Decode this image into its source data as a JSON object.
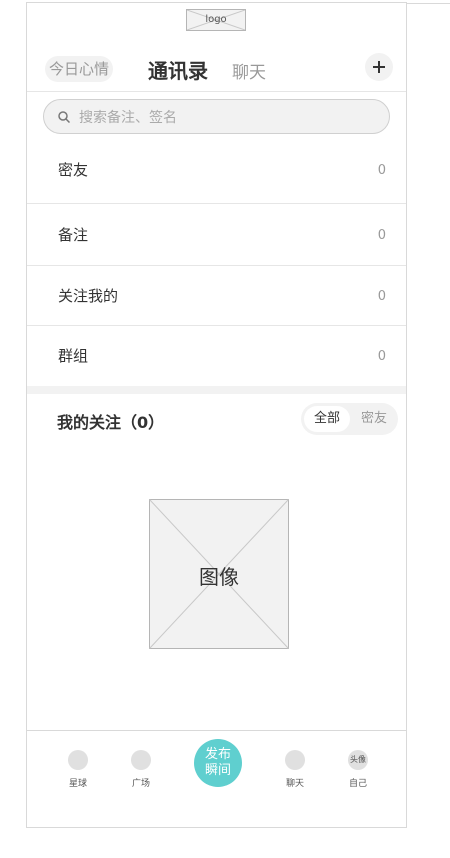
{
  "header": {
    "logo": "logo",
    "mood_button": "今日心情",
    "tab_contacts": "通讯录",
    "tab_chat": "聊天"
  },
  "search": {
    "placeholder": "搜索备注、签名"
  },
  "contact_groups": [
    {
      "label": "密友",
      "count": "0"
    },
    {
      "label": "备注",
      "count": "0"
    },
    {
      "label": "关注我的",
      "count": "0"
    },
    {
      "label": "群组",
      "count": "0"
    }
  ],
  "following": {
    "title": "我的关注（0）",
    "filter_all": "全部",
    "filter_friends": "密友",
    "image_placeholder": "图像"
  },
  "bottom_nav": {
    "planet": "星球",
    "square": "广场",
    "publish": "发布瞬间",
    "chat": "聊天",
    "avatar": "头像",
    "self": "自己"
  },
  "colors": {
    "accent": "#5fcfcf",
    "border": "#d9d9d9",
    "muted": "#999999",
    "panel": "#f2f2f2"
  }
}
